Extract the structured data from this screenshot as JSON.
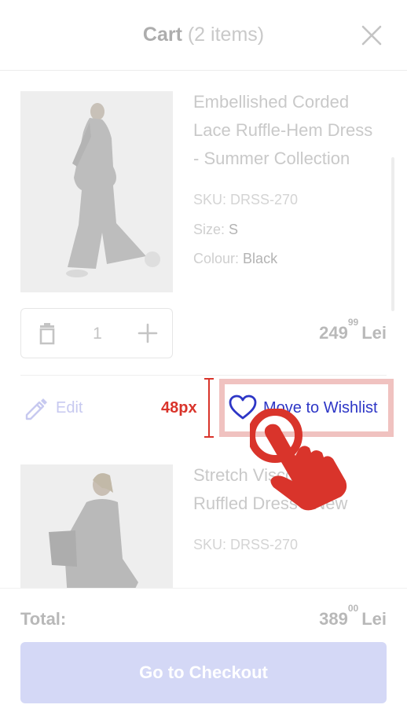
{
  "header": {
    "title": "Cart",
    "count": "(2 items)"
  },
  "items": [
    {
      "name_lines": [
        "Embellished Corded",
        "Lace Ruffle-Hem Dress",
        "- Summer Collection"
      ],
      "sku": "SKU: DRSS-270",
      "size_label": "Size:",
      "size_value": "S",
      "colour_label": "Colour:",
      "colour_value": "Black",
      "quantity": "1",
      "price_main": "249",
      "price_cents": "99",
      "currency": "Lei"
    },
    {
      "name_lines": [
        "Stretch Viscose",
        "Ruffled Dress - New"
      ],
      "sku": "SKU: DRSS-270"
    }
  ],
  "actions": {
    "edit_label": "Edit",
    "wishlist_label": "Move to Wishlist"
  },
  "annotation": {
    "target_size_label": "48px",
    "highlight_color": "#f0c2c0",
    "marker_color": "#d9342b"
  },
  "footer": {
    "total_label": "Total:",
    "total_main": "389",
    "total_cents": "00",
    "currency": "Lei",
    "checkout_label": "Go to Checkout"
  },
  "colors": {
    "accent": "#2d36c6",
    "checkout_bg": "#d4d8f6"
  },
  "icons": [
    "close-icon",
    "trash-icon",
    "plus-icon",
    "pencil-icon",
    "heart-icon",
    "pointing-hand-icon"
  ]
}
